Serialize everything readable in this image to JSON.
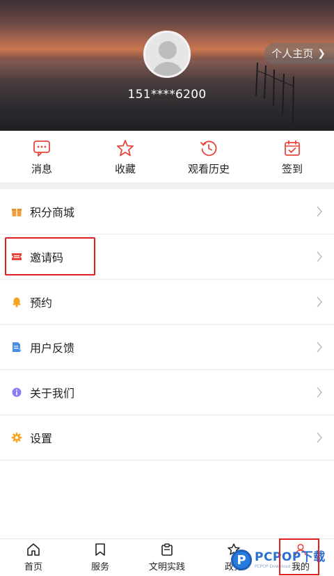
{
  "header": {
    "phone": "151****6200",
    "homepage_label": "个人主页"
  },
  "quick_actions": [
    {
      "label": "消息",
      "icon": "message-icon"
    },
    {
      "label": "收藏",
      "icon": "star-icon"
    },
    {
      "label": "观看历史",
      "icon": "history-icon"
    },
    {
      "label": "签到",
      "icon": "checkin-icon"
    }
  ],
  "menu": [
    {
      "label": "积分商城",
      "icon": "gift-icon",
      "color": "#f0a040"
    },
    {
      "label": "邀请码",
      "icon": "ticket-icon",
      "color": "#e8453c"
    },
    {
      "label": "预约",
      "icon": "bell-icon",
      "color": "#f5a623"
    },
    {
      "label": "用户反馈",
      "icon": "feedback-icon",
      "color": "#4a90e2"
    },
    {
      "label": "关于我们",
      "icon": "info-icon",
      "color": "#8b7cf0"
    },
    {
      "label": "设置",
      "icon": "gear-icon",
      "color": "#f5a623"
    }
  ],
  "tabs": [
    {
      "label": "首页",
      "icon": "home-icon"
    },
    {
      "label": "服务",
      "icon": "bookmark-icon"
    },
    {
      "label": "文明实践",
      "icon": "clipboard-icon"
    },
    {
      "label": "政务",
      "icon": "gov-icon"
    },
    {
      "label": "我的",
      "icon": "user-icon",
      "active": true
    }
  ],
  "watermark": {
    "logo_letter": "P",
    "text": "PCPOP下载",
    "sub": "PCPOP Download"
  },
  "colors": {
    "accent_red": "#e8453c",
    "highlight_border": "#e02020"
  }
}
